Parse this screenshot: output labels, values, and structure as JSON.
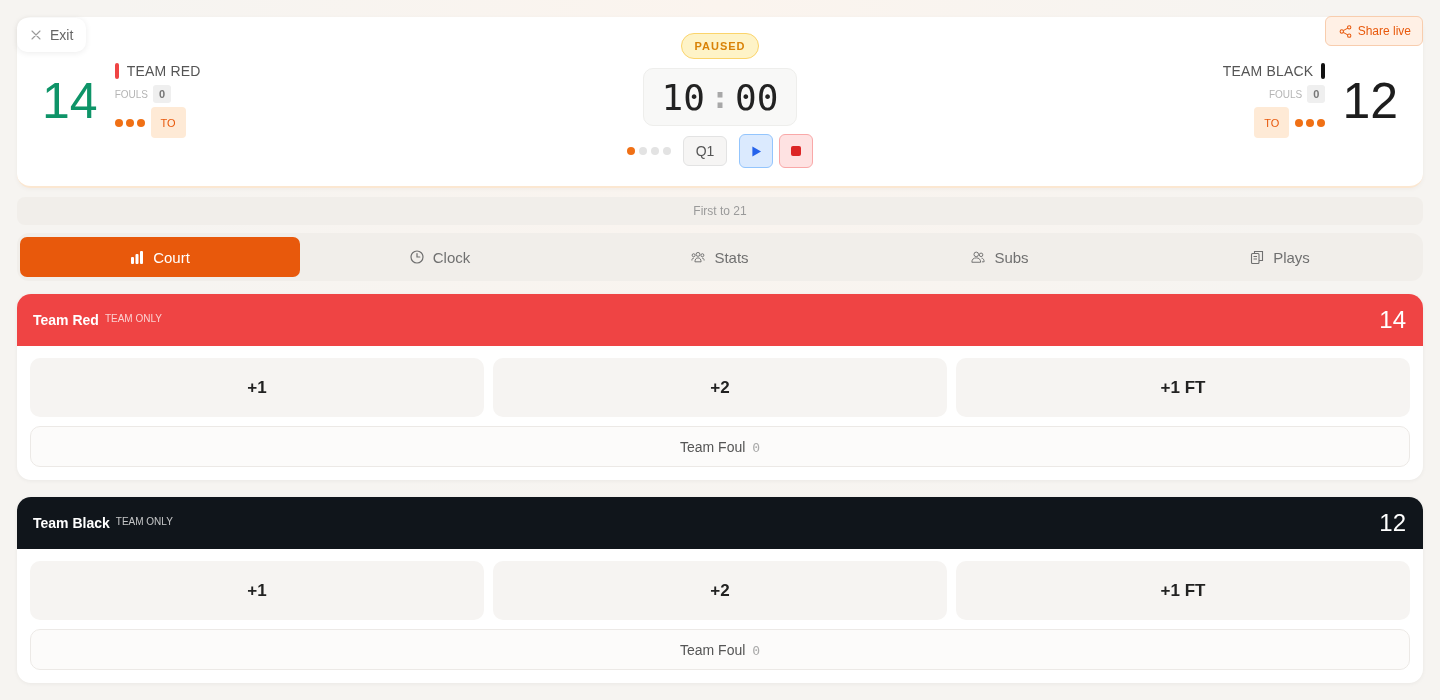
{
  "exit_button": {
    "label": "Exit"
  },
  "share_button": {
    "label": "Share live"
  },
  "teams": [
    {
      "name": "TEAM RED",
      "color": "#ef4444",
      "score": "14",
      "leading": true,
      "fouls_label": "FOULS",
      "fouls": "0",
      "timeouts": [
        {
          "on": true
        },
        {
          "on": true
        },
        {
          "on": true
        }
      ],
      "timeout_button": "TO"
    },
    {
      "name": "TEAM BLACK",
      "color": "#111111",
      "score": "12",
      "leading": false,
      "fouls_label": "FOULS",
      "fouls": "0",
      "timeouts": [
        {
          "on": true
        },
        {
          "on": true
        },
        {
          "on": true
        }
      ],
      "timeout_button": "TO"
    }
  ],
  "clock": {
    "status": "PAUSED",
    "minutes": "10",
    "separator": ":",
    "seconds": "00",
    "period_dots": [
      {
        "on": true
      },
      {
        "on": false
      },
      {
        "on": false
      },
      {
        "on": false
      }
    ],
    "period": "Q1",
    "running": false
  },
  "goal": "First to 21",
  "tabs": [
    {
      "label": "Court",
      "selected": true
    },
    {
      "label": "Clock",
      "selected": false
    },
    {
      "label": "Stats",
      "selected": false
    },
    {
      "label": "Subs",
      "selected": false
    },
    {
      "label": "Plays",
      "selected": false
    }
  ],
  "panels": [
    {
      "name": "Team Red",
      "tag": "TEAM ONLY",
      "score": "14",
      "color": "#ef4444",
      "actions": [
        "+1",
        "+2",
        "+1 FT"
      ],
      "foul_label": "Team Foul",
      "fouls": "0"
    },
    {
      "name": "Team Black",
      "tag": "TEAM ONLY",
      "score": "12",
      "color": "#10151b",
      "actions": [
        "+1",
        "+2",
        "+1 FT"
      ],
      "foul_label": "Team Foul",
      "fouls": "0"
    }
  ]
}
